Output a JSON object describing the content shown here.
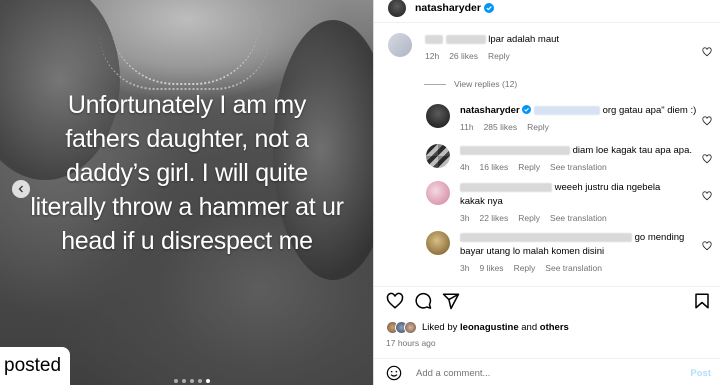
{
  "media": {
    "caption_lines": [
      "Unfortunately I am my",
      "fathers daughter, not a",
      "daddy’s girl. I will quite",
      "literally throw a hammer at ur",
      "head if u disrespect me"
    ],
    "badge_text": "posted",
    "carousel_dots": 5,
    "active_dot": 4
  },
  "post": {
    "author": "natasharyder",
    "verified_color": "#0095f6"
  },
  "comments": [
    {
      "text": "lpar adalah maut",
      "time": "12h",
      "likes": "26 likes",
      "reply": "Reply",
      "avatar_color": "#c8ccd6"
    },
    {
      "author": "natasharyder",
      "text": "org gatau apa\" diem :)",
      "time": "11h",
      "likes": "285 likes",
      "reply": "Reply",
      "avatar_color": "#2b2b2b"
    },
    {
      "text": "diam loe kagak tau apa apa.",
      "time": "4h",
      "likes": "16 likes",
      "reply": "Reply",
      "see_translation": "See translation",
      "avatar_color": "#555"
    },
    {
      "text_line1": "weeeh justru dia ngebela",
      "text_line2": "kakak nya",
      "time": "3h",
      "likes": "22 likes",
      "reply": "Reply",
      "see_translation": "See translation",
      "avatar_color": "#e8b9c6"
    },
    {
      "text_line1": "go mending",
      "text_line2": "bayar utang lo malah komen disini",
      "time": "3h",
      "likes": "9 likes",
      "reply": "Reply",
      "see_translation": "See translation",
      "avatar_color": "#b89b6a"
    }
  ],
  "view_replies": "View replies (12)",
  "actions": {
    "like_icon": "heart-icon",
    "comment_icon": "comment-icon",
    "share_icon": "share-icon",
    "save_icon": "bookmark-icon"
  },
  "likes": {
    "prefix": "Liked by ",
    "user": "leonagustine",
    "middle": " and ",
    "others": "others"
  },
  "timestamp": "17 hours ago",
  "add_comment": {
    "placeholder": "Add a comment...",
    "post_label": "Post"
  }
}
